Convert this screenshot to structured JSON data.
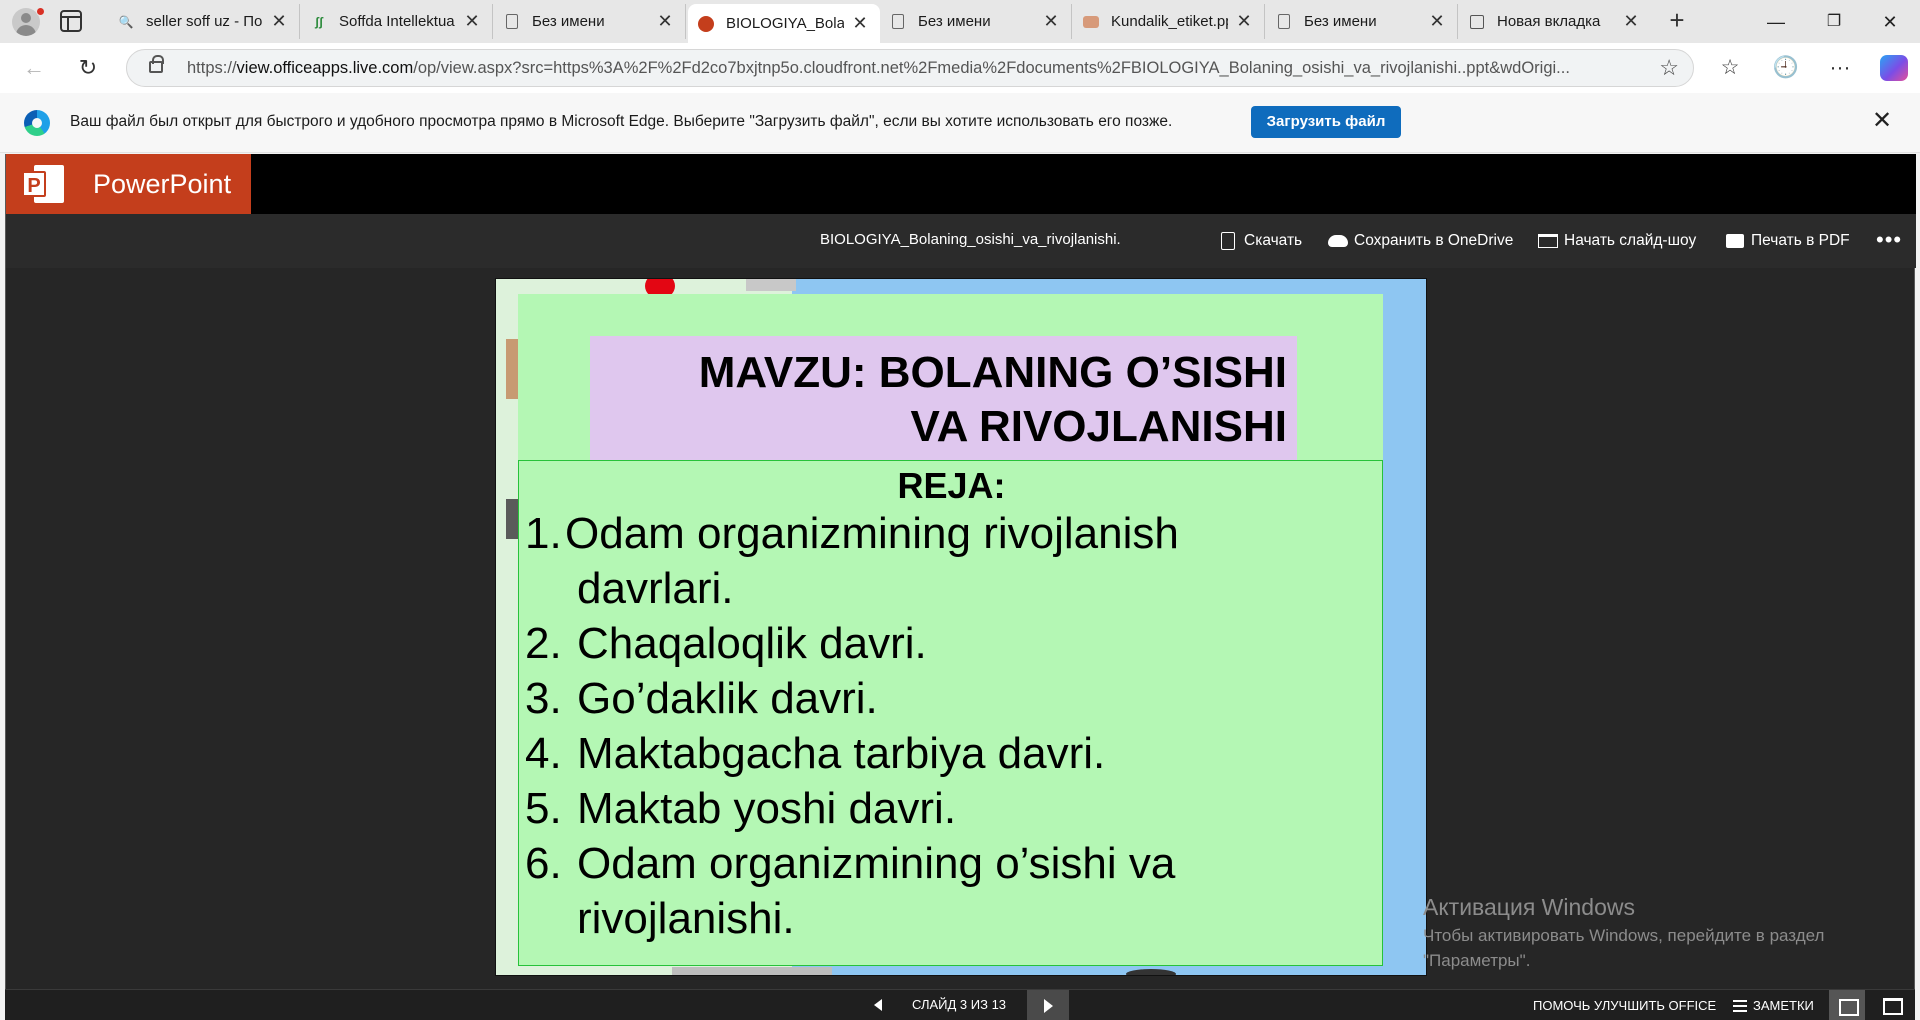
{
  "browser": {
    "tabs": [
      {
        "title": "seller soff uz - По",
        "icon": "search-icon",
        "active": false
      },
      {
        "title": "Soffda Intellektua",
        "icon": "soff-logo-icon",
        "active": false
      },
      {
        "title": "Без имени",
        "icon": "document-icon",
        "active": false
      },
      {
        "title": "BIOLOGIYA_Bolan",
        "icon": "powerpoint-icon",
        "active": true
      },
      {
        "title": "Без имени",
        "icon": "document-icon",
        "active": false
      },
      {
        "title": "Kundalik_etiket.pp",
        "icon": "powerpoint-icon",
        "active": false
      },
      {
        "title": "Без имени",
        "icon": "document-icon",
        "active": false
      },
      {
        "title": "Новая вкладка",
        "icon": "new-tab-page-icon",
        "active": false
      }
    ],
    "url": {
      "prefix": "https://",
      "host": "view.officeapps.live.com",
      "rest": "/op/view.aspx?src=https%3A%2F%2Fd2co7bxjtnp5o.cloudfront.net%2Fmedia%2Fdocuments%2FBIOLOGIYA_Bolaning_osishi_va_rivojlanishi..ppt&wdOrigi..."
    }
  },
  "infobar": {
    "message": "Ваш файл был открыт для быстрого и удобного просмотра прямо в Microsoft Edge. Выберите \"Загрузить файл\", если вы хотите использовать его позже.",
    "button": "Загрузить файл"
  },
  "ppt": {
    "brand": "PowerPoint",
    "doc_title": "BIOLOGIYA_Bolaning_osishi_va_rivojlanishi.",
    "commands": {
      "download": "Скачать",
      "onedrive": "Сохранить в OneDrive",
      "slideshow": "Начать слайд-шоу",
      "print": "Печать в PDF"
    },
    "accent_color": "#c43e1c"
  },
  "slide": {
    "title_line1": "MAVZU: BOLANING O’SISHI",
    "title_line2": "VA RIVOJLANISHI",
    "plan_heading": "REJA:",
    "items": [
      {
        "num": "1.",
        "text": "Odam organizmining rivojlanish"
      },
      {
        "num": "",
        "text": "davrlari."
      },
      {
        "num": "2.",
        "text": "Chaqaloqlik davri."
      },
      {
        "num": "3.",
        "text": "Go’daklik davri."
      },
      {
        "num": "4.",
        "text": "Maktabgacha tarbiya davri."
      },
      {
        "num": "5.",
        "text": "Maktab yoshi davri."
      },
      {
        "num": "6.",
        "text": "Odam organizmining o’sishi va"
      },
      {
        "num": "",
        "text": "rivojlanishi."
      }
    ]
  },
  "watermark": {
    "title": "Активация Windows",
    "line1": "Чтобы активировать Windows, перейдите в раздел",
    "line2": "\"Параметры\"."
  },
  "statusbar": {
    "counter": "СЛАЙД 3 ИЗ 13",
    "help": "ПОМОЧЬ УЛУЧШИТЬ OFFICE",
    "notes": "ЗАМЕТКИ"
  }
}
